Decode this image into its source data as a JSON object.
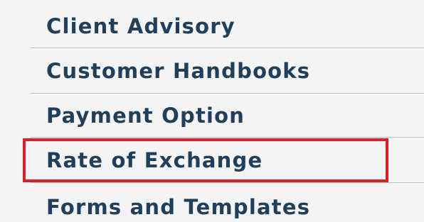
{
  "menu": {
    "items": [
      {
        "label": "Client Advisory"
      },
      {
        "label": "Customer Handbooks"
      },
      {
        "label": "Payment Option"
      },
      {
        "label": "Rate of Exchange",
        "highlighted": true
      },
      {
        "label": "Forms and Templates"
      }
    ]
  },
  "colors": {
    "background": "#f4f4f5",
    "label_text": "#1f3f5a",
    "divider": "#b9c2c9",
    "highlight_border": "#e01e27"
  }
}
